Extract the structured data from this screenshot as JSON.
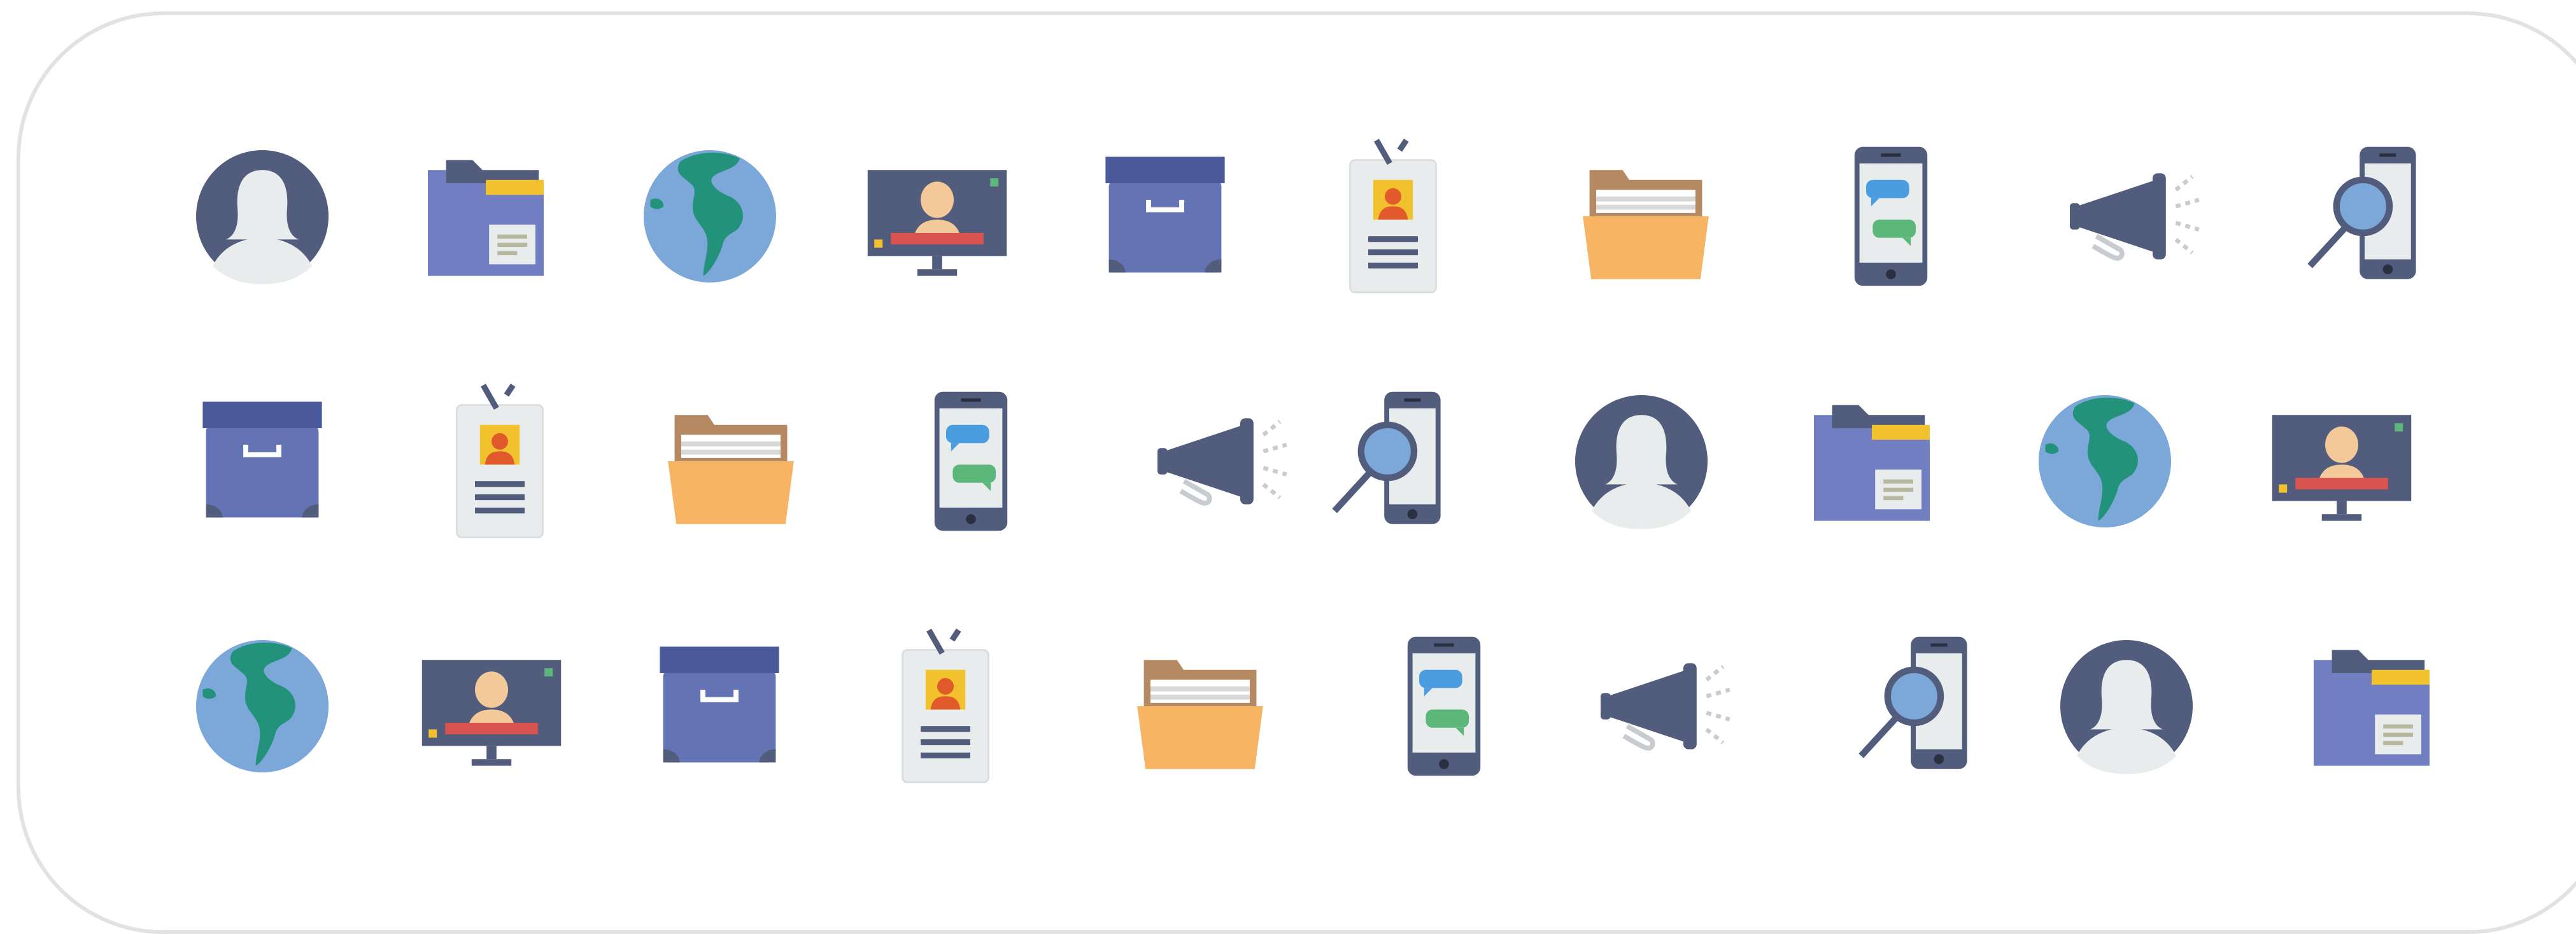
{
  "icon_set": {
    "rows": [
      [
        "user-avatar-icon",
        "folder-document-icon",
        "globe-icon",
        "monitor-profile-icon",
        "archive-box-icon",
        "id-badge-icon",
        "open-folder-icon",
        "chat-phone-icon",
        "megaphone-icon",
        "phone-search-icon"
      ],
      [
        "archive-box-icon",
        "id-badge-icon",
        "open-folder-icon",
        "chat-phone-icon",
        "megaphone-icon",
        "phone-search-icon",
        "user-avatar-icon",
        "folder-document-icon",
        "globe-icon",
        "monitor-profile-icon"
      ],
      [
        "globe-icon",
        "monitor-profile-icon",
        "archive-box-icon",
        "id-badge-icon",
        "open-folder-icon",
        "chat-phone-icon",
        "megaphone-icon",
        "phone-search-icon",
        "user-avatar-icon",
        "folder-document-icon"
      ]
    ]
  },
  "palette": {
    "navy": "#525c7c",
    "blue_folder": "#717fc2",
    "box_blue": "#6473b4",
    "box_lid": "#4a5a9a",
    "globe_blue": "#7ba7d9",
    "globe_green": "#22927a",
    "yellow": "#f2c12e",
    "orange": "#f7b462",
    "light_gray": "#e9ecec",
    "red": "#d9534f",
    "chat_blue": "#4a9de0",
    "chat_green": "#5cb87a"
  }
}
